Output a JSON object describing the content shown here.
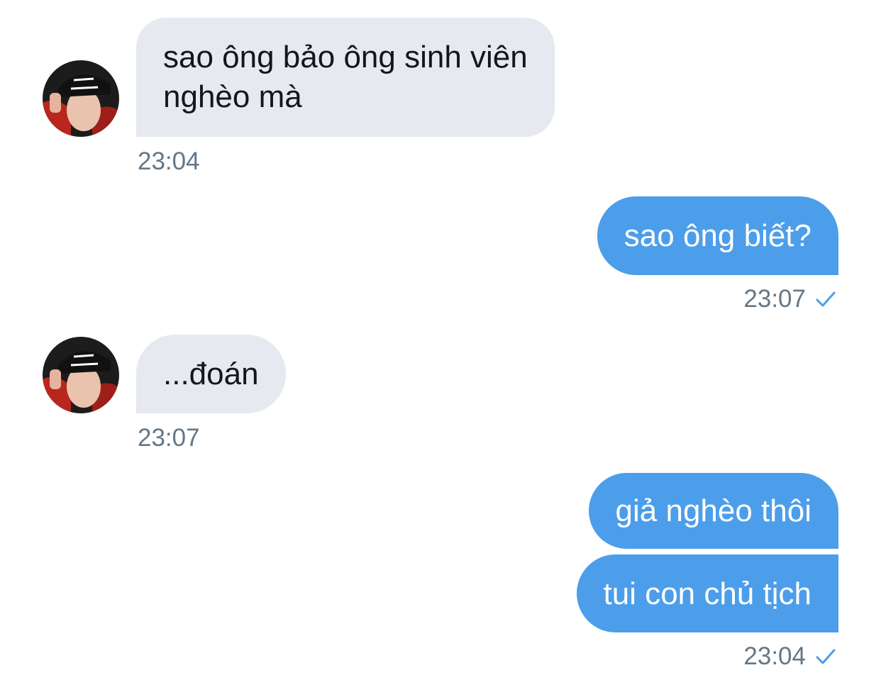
{
  "messages": [
    {
      "direction": "incoming",
      "lines": [
        "sao ông bảo ông sinh viên",
        "nghèo mà"
      ],
      "time": "23:04"
    },
    {
      "direction": "outgoing",
      "lines": [
        "sao ông biết?"
      ],
      "time": "23:07",
      "status_icon": "check-icon"
    },
    {
      "direction": "incoming",
      "lines": [
        "...đoán"
      ],
      "time": "23:07"
    },
    {
      "direction": "outgoing",
      "lines": [
        "giả nghèo thôi"
      ]
    },
    {
      "direction": "outgoing",
      "lines": [
        "tui con chủ tịch"
      ],
      "time": "23:04",
      "status_icon": "check-icon"
    }
  ],
  "colors": {
    "incoming_bubble": "#e6e9ef",
    "outgoing_bubble": "#4c9eea",
    "timestamp": "#657786",
    "check": "#4c9eea"
  }
}
